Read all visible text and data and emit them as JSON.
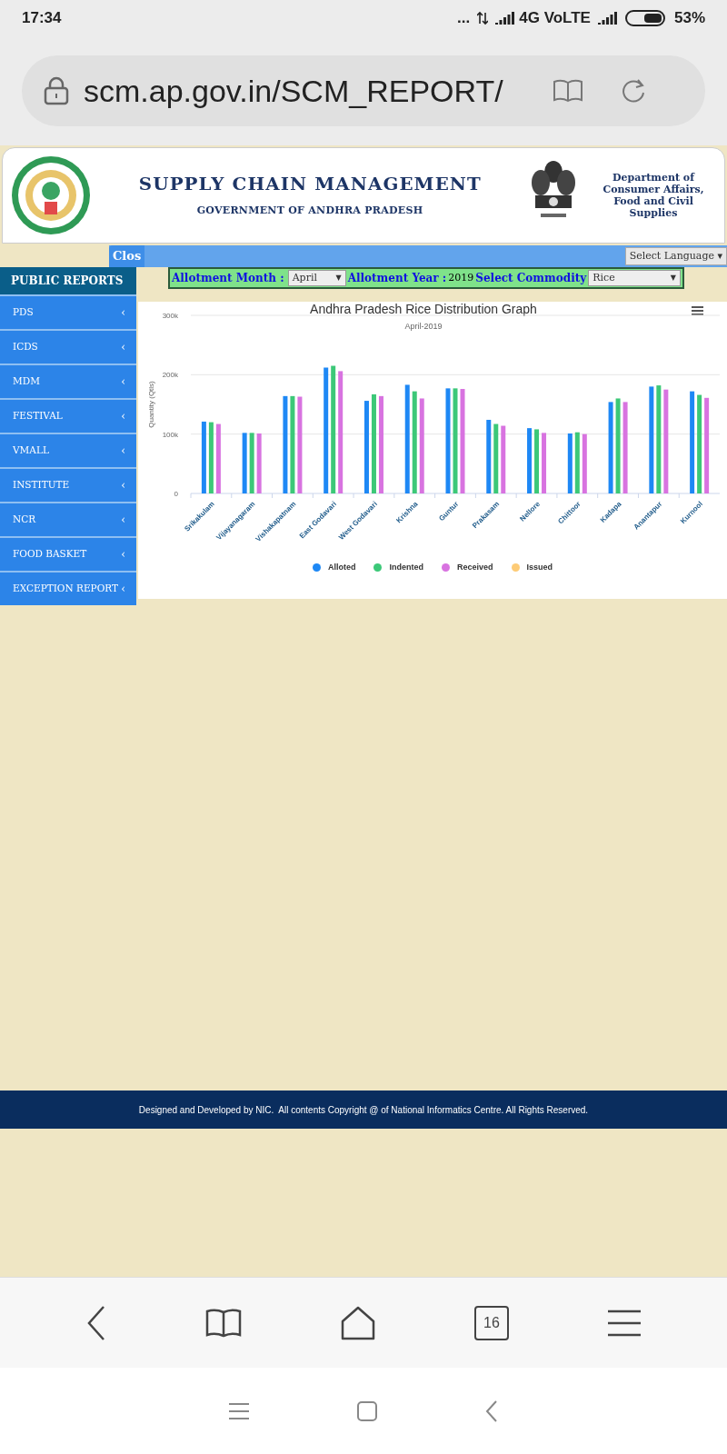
{
  "status_bar": {
    "time": "17:34",
    "dots": "...",
    "network": "4G VoLTE",
    "battery": "53%"
  },
  "browser": {
    "url": "scm.ap.gov.in/SCM_REPORT/",
    "tab_count": "16"
  },
  "header": {
    "title": "SUPPLY CHAIN MANAGEMENT",
    "subtitle": "GOVERNMENT OF ANDHRA PRADESH",
    "department": "Department of Consumer Affairs, Food and Civil Supplies"
  },
  "toolbar": {
    "close_tab": "Clos",
    "language": "Select Language ▾"
  },
  "sidebar": {
    "title": "PUBLIC REPORTS",
    "items": [
      {
        "label": "PDS",
        "arrow": "‹"
      },
      {
        "label": "ICDS",
        "arrow": "‹"
      },
      {
        "label": "MDM",
        "arrow": "‹"
      },
      {
        "label": "FESTIVAL",
        "arrow": "‹"
      },
      {
        "label": "VMALL",
        "arrow": "‹"
      },
      {
        "label": "INSTITUTE",
        "arrow": "‹"
      },
      {
        "label": "NCR",
        "arrow": "‹"
      },
      {
        "label": "FOOD BASKET",
        "arrow": "‹"
      },
      {
        "label": "EXCEPTION REPORT",
        "arrow": "‹"
      }
    ]
  },
  "filters": {
    "month_label": "Allotment Month :",
    "month": "April",
    "month_caret": "▼",
    "year_label": "Allotment Year :",
    "year": "2019",
    "commodity_label": "Select Commodity",
    "commodity": "Rice",
    "commodity_caret": "▼"
  },
  "chart": {
    "chart_data": {
      "type": "bar",
      "title": "Andhra Pradesh Rice Distribution Graph",
      "subtitle": "April-2019",
      "ylabel": "Quantity (Qtls)",
      "categories": [
        "Srikakulam",
        "Vijayanagaram",
        "Vishakapatnam",
        "East Godavari",
        "West Godavari",
        "Krishna",
        "Guntur",
        "Prakasam",
        "Nellore",
        "Chittoor",
        "Kadapa",
        "Anantapur",
        "Kurnool"
      ],
      "ylim": [
        0,
        300000
      ],
      "legend": true,
      "yticks": [
        {
          "value": 0,
          "label": "0"
        },
        {
          "value": 100000,
          "label": "100k"
        },
        {
          "value": 200000,
          "label": "200k"
        },
        {
          "value": 300000,
          "label": "300k"
        }
      ],
      "series": [
        {
          "name": "Alloted",
          "color": "#1e88f5",
          "values": [
            121000,
            102000,
            164000,
            212000,
            156000,
            183000,
            177000,
            124000,
            110000,
            101000,
            154000,
            180000,
            172000
          ]
        },
        {
          "name": "Indented",
          "color": "#3cc878",
          "values": [
            120000,
            102000,
            164000,
            215000,
            167000,
            172000,
            177000,
            117000,
            108000,
            103000,
            160000,
            182000,
            166000
          ]
        },
        {
          "name": "Received",
          "color": "#d873e0",
          "values": [
            117000,
            101000,
            163000,
            206000,
            164000,
            160000,
            176000,
            114000,
            102000,
            100000,
            154000,
            175000,
            161000
          ]
        },
        {
          "name": "Issued",
          "color": "#fdcb76",
          "values": [
            null,
            null,
            null,
            null,
            null,
            null,
            null,
            null,
            null,
            null,
            null,
            null,
            null
          ]
        }
      ]
    }
  },
  "footer": {
    "text": "Designed and Developed by NIC.  All contents Copyright @ of National Informatics Centre. All Rights Reserved."
  }
}
